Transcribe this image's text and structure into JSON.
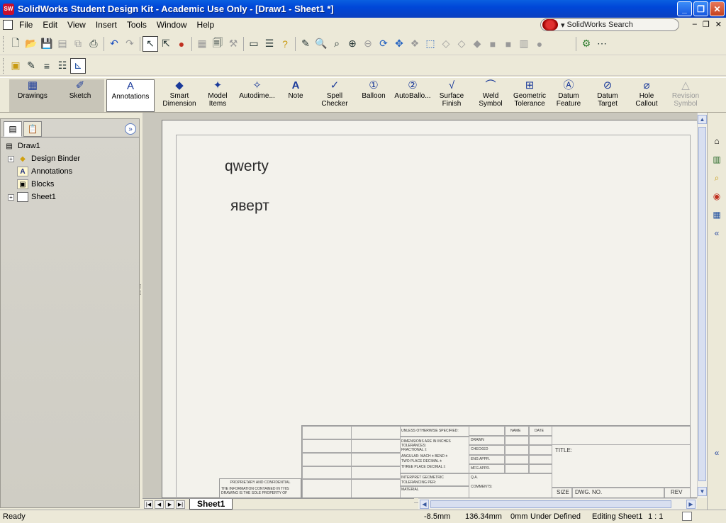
{
  "window": {
    "title": "SolidWorks Student Design Kit - Academic Use Only - [Draw1 - Sheet1 *]",
    "app_icon_text": "SW"
  },
  "menu": {
    "items": [
      "File",
      "Edit",
      "View",
      "Insert",
      "Tools",
      "Window",
      "Help"
    ]
  },
  "search": {
    "label": "SolidWorks Search"
  },
  "command_manager": {
    "tabs": [
      {
        "label": "Drawings"
      },
      {
        "label": "Sketch"
      },
      {
        "label": "Annotations"
      }
    ],
    "commands": [
      {
        "label": "Smart Dimension",
        "icon": "smart-dimension-icon"
      },
      {
        "label": "Model Items",
        "icon": "model-items-icon"
      },
      {
        "label": "Autodime...",
        "icon": "autodimension-icon"
      },
      {
        "label": "Note",
        "icon": "note-icon"
      },
      {
        "label": "Spell Checker",
        "icon": "spell-checker-icon"
      },
      {
        "label": "Balloon",
        "icon": "balloon-icon"
      },
      {
        "label": "AutoBallo...",
        "icon": "auto-balloon-icon"
      },
      {
        "label": "Surface Finish",
        "icon": "surface-finish-icon"
      },
      {
        "label": "Weld Symbol",
        "icon": "weld-symbol-icon"
      },
      {
        "label": "Geometric Tolerance",
        "icon": "geometric-tolerance-icon"
      },
      {
        "label": "Datum Feature",
        "icon": "datum-feature-icon"
      },
      {
        "label": "Datum Target",
        "icon": "datum-target-icon"
      },
      {
        "label": "Hole Callout",
        "icon": "hole-callout-icon"
      },
      {
        "label": "Revision Symbol",
        "icon": "revision-symbol-icon"
      }
    ]
  },
  "tree": {
    "root": "Draw1",
    "items": [
      {
        "label": "Design Binder",
        "expandable": true
      },
      {
        "label": "Annotations",
        "expandable": false
      },
      {
        "label": "Blocks",
        "expandable": false
      },
      {
        "label": "Sheet1",
        "expandable": true
      }
    ]
  },
  "drawing": {
    "notes": [
      "qwerty",
      "яверт"
    ],
    "title_block": {
      "tolerance_header": "UNLESS OTHERWISE SPECIFIED:",
      "name": "NAME",
      "date": "DATE",
      "drawn": "DRAWN",
      "checked": "CHECKED",
      "eng_appr": "ENG APPR.",
      "mfg_appr": "MFG APPR.",
      "qa": "Q.A.",
      "comments": "COMMENTS:",
      "title": "TITLE:",
      "size": "SIZE",
      "dwg_no": "DWG.  NO.",
      "rev": "REV",
      "dimensions": "DIMENSIONS ARE IN INCHES",
      "tolerances": "TOLERANCES:",
      "fractional": "FRACTIONAL ±",
      "angular": "ANGULAR: MACH ±   BEND ±",
      "two_place": "TWO PLACE DECIMAL   ±",
      "three_place": "THREE PLACE DECIMAL   ±",
      "interpret": "INTERPRET GEOMETRIC",
      "tolerancing": "TOLERANCING PER:",
      "material": "MATERIAL",
      "proprietary": "PROPRIETARY AND CONFIDENTIAL",
      "prop_text": "THE INFORMATION CONTAINED IN THIS DRAWING IS THE SOLE PROPERTY OF"
    }
  },
  "sheet_tabs": {
    "active": "Sheet1"
  },
  "status": {
    "left": "Ready",
    "x": "-8.5mm",
    "y": "136.34mm",
    "z": "0mm",
    "definition": "Under Defined",
    "mode": "Editing Sheet1",
    "scale": "1 : 1"
  }
}
